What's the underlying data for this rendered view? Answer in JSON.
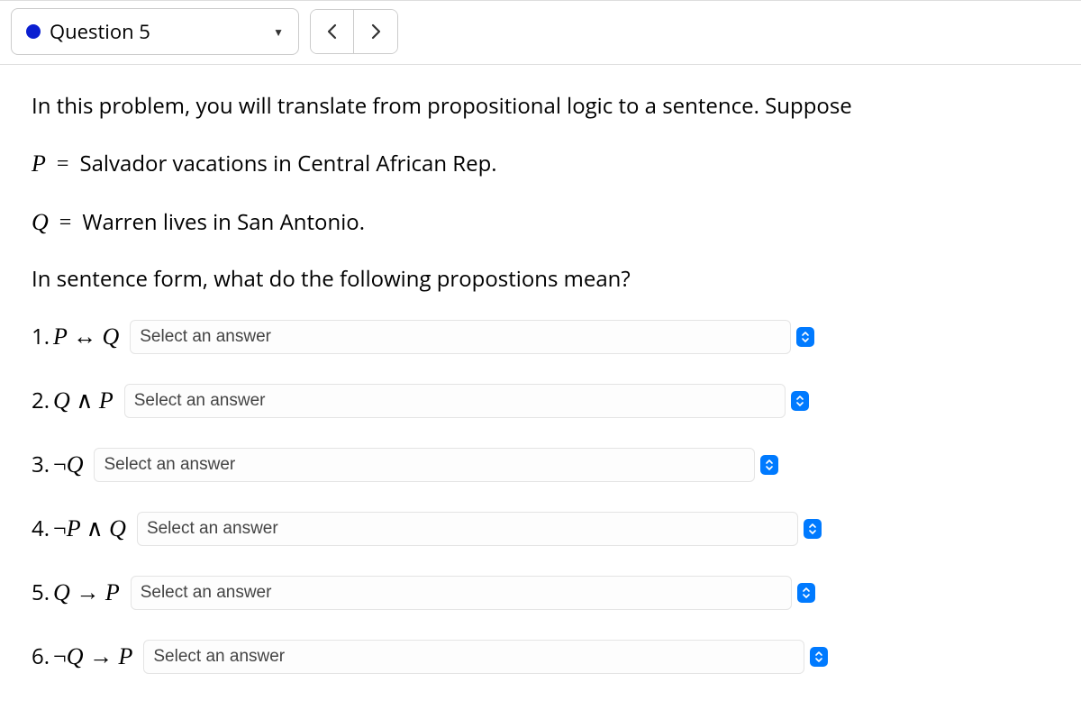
{
  "header": {
    "question_label": "Question 5",
    "prev": "‹",
    "next": "›"
  },
  "content": {
    "intro": "In this problem, you will translate from propositional logic to a sentence. Suppose",
    "definitions": [
      {
        "var": "P",
        "text": "Salvador vacations in Central African Rep."
      },
      {
        "var": "Q",
        "text": "Warren lives in San Antonio."
      }
    ],
    "instruction": "In sentence form, what do the following propostions mean?",
    "select_placeholder": "Select an answer",
    "sub_questions": [
      {
        "num": "1.",
        "expr_html": "P ↔ Q"
      },
      {
        "num": "2.",
        "expr_html": "Q ∧ P"
      },
      {
        "num": "3.",
        "expr_html": "¬Q"
      },
      {
        "num": "4.",
        "expr_html": "¬P ∧ Q"
      },
      {
        "num": "5.",
        "expr_html": "Q → P"
      },
      {
        "num": "6.",
        "expr_html": "¬Q → P"
      }
    ]
  }
}
